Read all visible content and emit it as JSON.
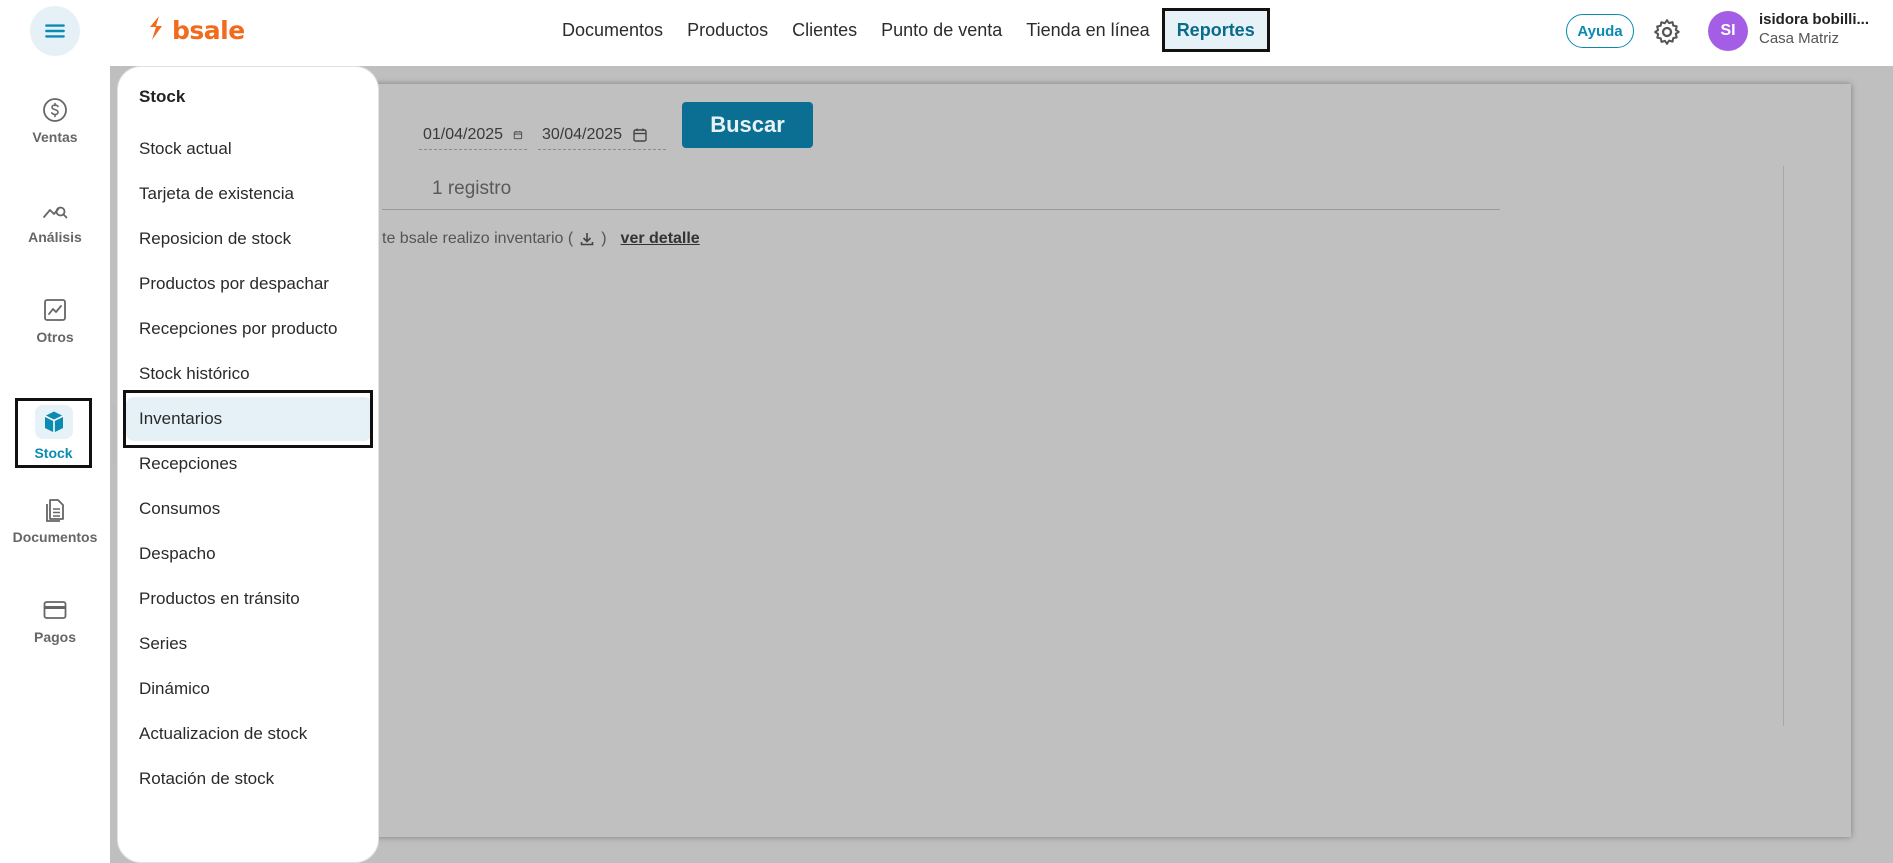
{
  "brand": {
    "name": "bsale",
    "color": "#f26a1b",
    "accent": "#0b8ab3"
  },
  "topnav": {
    "items": [
      {
        "label": "Documentos"
      },
      {
        "label": "Productos"
      },
      {
        "label": "Clientes"
      },
      {
        "label": "Punto de venta"
      },
      {
        "label": "Tienda en línea"
      },
      {
        "label": "Reportes",
        "active": true
      }
    ]
  },
  "header": {
    "help_label": "Ayuda",
    "avatar_initials": "SI",
    "user_name": "isidora bobilli...",
    "branch": "Casa Matriz"
  },
  "rail": {
    "items": [
      {
        "label": "Ventas",
        "icon": "dollar-icon"
      },
      {
        "label": "Análisis",
        "icon": "analysis-icon"
      },
      {
        "label": "Otros",
        "icon": "chart-box-icon"
      },
      {
        "label": "Stock",
        "icon": "box-icon",
        "active": true
      },
      {
        "label": "Documentos",
        "icon": "document-icon"
      },
      {
        "label": "Pagos",
        "icon": "card-icon"
      }
    ]
  },
  "menu": {
    "title": "Stock",
    "items": [
      {
        "label": "Stock actual"
      },
      {
        "label": "Tarjeta de existencia"
      },
      {
        "label": "Reposicion de stock"
      },
      {
        "label": "Productos por despachar"
      },
      {
        "label": "Recepciones por producto"
      },
      {
        "label": "Stock histórico"
      },
      {
        "label": "Inventarios",
        "active": true
      },
      {
        "label": "Recepciones"
      },
      {
        "label": "Consumos"
      },
      {
        "label": "Despacho"
      },
      {
        "label": "Productos en tránsito"
      },
      {
        "label": "Series"
      },
      {
        "label": "Dinámico"
      },
      {
        "label": "Actualizacion de stock"
      },
      {
        "label": "Rotación de stock"
      }
    ]
  },
  "main": {
    "date_from": "01/04/2025",
    "date_to": "30/04/2025",
    "search_label": "Buscar",
    "records_label": "1 registro",
    "row_text_before": "te bsale realizo inventario (",
    "row_text_after": ")",
    "row_link": "ver detalle"
  }
}
